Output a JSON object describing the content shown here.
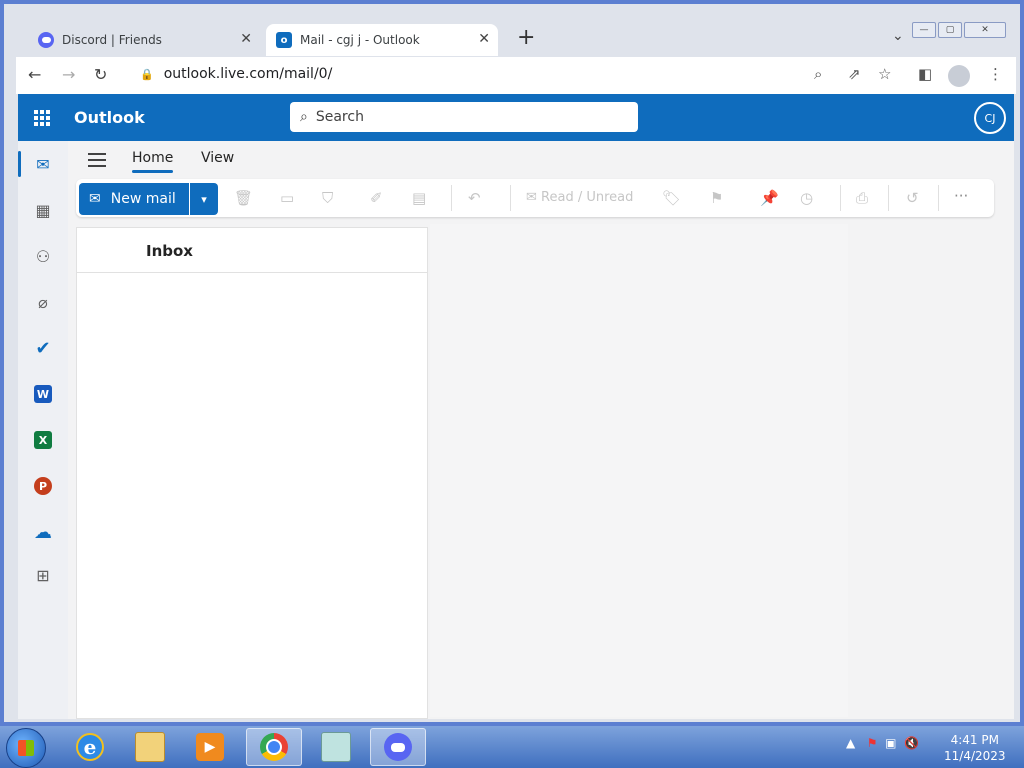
{
  "browser": {
    "tabs": [
      {
        "title": "Discord | Friends",
        "icon": "discord-icon",
        "active": false
      },
      {
        "title": "Mail - cgj j - Outlook",
        "icon": "outlook-icon",
        "active": true
      }
    ],
    "new_tab_symbol": "+",
    "close_symbol": "✕",
    "address": "outlook.live.com/mail/0/"
  },
  "outlook": {
    "brand": "Outlook",
    "search_placeholder": "Search",
    "avatar_initials": "CJ",
    "ribbon_tabs": [
      "Home",
      "View"
    ],
    "active_ribbon_tab": "Home",
    "new_mail_label": "New mail",
    "read_unread_label": "Read / Unread",
    "more_label": "···",
    "folder_title": "Inbox",
    "rail_items": [
      "mail-icon",
      "calendar-icon",
      "people-icon",
      "attachment-icon",
      "todo-icon",
      "word-icon",
      "excel-icon",
      "powerpoint-icon",
      "onedrive-icon",
      "more-apps-icon"
    ],
    "app_letters": {
      "word": "W",
      "excel": "X",
      "powerpoint": "P"
    },
    "accent_color": "#0f6cbd"
  },
  "taskbar": {
    "apps": [
      "internet-explorer-icon",
      "file-explorer-icon",
      "media-player-icon",
      "chrome-icon",
      "notepad-icon",
      "discord-icon"
    ],
    "active_app": "chrome-icon",
    "time": "4:41 PM",
    "date": "11/4/2023"
  }
}
